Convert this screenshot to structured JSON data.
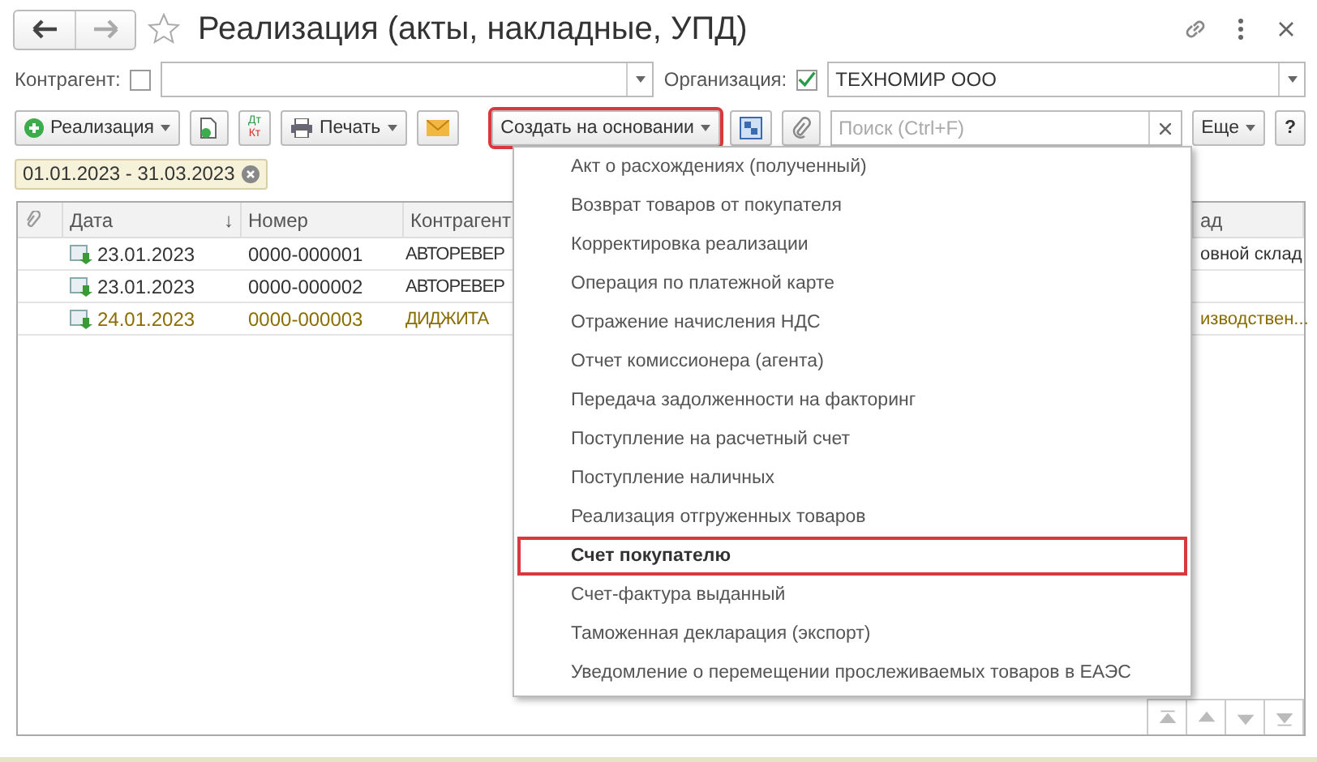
{
  "window": {
    "title": "Реализация (акты, накладные, УПД)"
  },
  "filters": [
    {
      "label": "Контрагент:",
      "checked": false
    },
    {
      "label": "Организация:",
      "checked": true,
      "value": "ТЕХНОМИР ООО"
    }
  ],
  "toolbar": {
    "create_button": "Реализация",
    "dt_kt": [
      "Дт",
      "Кт"
    ],
    "print_button": "Печать",
    "based_on_button": {
      "label": "Создать на основании",
      "highlighted": true
    },
    "search": {
      "placeholder": "Поиск (Ctrl+F)"
    },
    "more_button": "Еще",
    "help_button": "?"
  },
  "period": "01.01.2023 - 31.03.2023",
  "table": {
    "columns": [
      {
        "label": "Дата",
        "sort": "↓"
      },
      {
        "label": "Номер"
      },
      {
        "label": "Контрагент"
      },
      {
        "label": "ад"
      }
    ],
    "rows": [
      {
        "date": "23.01.2023",
        "number": "0000-000001",
        "counterparty": "АВТОРЕВЕР",
        "column_4": "овной склад",
        "highlighted": false
      },
      {
        "date": "23.01.2023",
        "number": "0000-000002",
        "counterparty": "АВТОРЕВЕР",
        "highlighted": false
      },
      {
        "date": "24.01.2023",
        "number": "0000-000003",
        "counterparty": "ДИДЖИТА",
        "column_4": "изводствен...",
        "highlighted": true
      }
    ]
  },
  "menu": {
    "items": [
      {
        "label": "Акт о расхождениях (полученный)",
        "selected": false
      },
      {
        "label": "Возврат товаров от покупателя",
        "selected": false
      },
      {
        "label": "Корректировка реализации",
        "selected": false
      },
      {
        "label": "Операция по платежной карте",
        "selected": false
      },
      {
        "label": "Отражение начисления НДС",
        "selected": false
      },
      {
        "label": "Отчет комиссионера (агента)",
        "selected": false
      },
      {
        "label": "Передача задолженности на факторинг",
        "selected": false
      },
      {
        "label": "Поступление на расчетный счет",
        "selected": false
      },
      {
        "label": "Поступление наличных",
        "selected": false
      },
      {
        "label": "Реализация отгруженных товаров",
        "selected": false
      },
      {
        "label": "Счет покупателю",
        "selected": true
      },
      {
        "label": "Счет-фактура выданный",
        "selected": false
      },
      {
        "label": "Таможенная декларация (экспорт)",
        "selected": false
      },
      {
        "label": "Уведомление о перемещении прослеживаемых товаров в ЕАЭС",
        "selected": false
      }
    ]
  }
}
